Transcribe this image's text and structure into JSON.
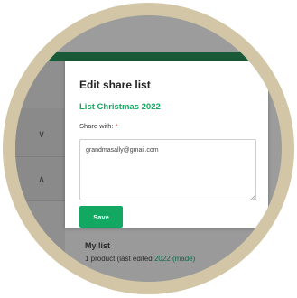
{
  "modal": {
    "title": "Edit share list",
    "list_name": "List Christmas 2022",
    "share_label": "Share with:",
    "required_mark": "*",
    "share_value": "grandmasally@gmail.com",
    "save_label": "Save"
  },
  "background": {
    "list_title": "My list",
    "list_meta_prefix": "1 product (last edited ",
    "list_meta_link": "2022 (made)"
  },
  "icons": {
    "left_upper": "chevron-down-icon",
    "left_lower": "chevron-up-icon",
    "resize": "resize-grip-icon"
  },
  "colors": {
    "frame": "#d2c6a6",
    "brand_green": "#12a862",
    "header_green": "#1a5a38",
    "overlay_gray": "#9c9c9c"
  }
}
